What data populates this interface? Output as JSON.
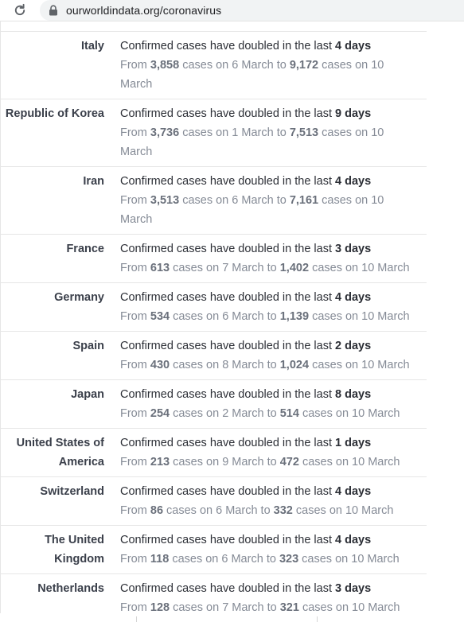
{
  "browser": {
    "url": "ourworldindata.org/coronavirus",
    "reload_icon": "reload-icon",
    "lock_icon": "lock-icon"
  },
  "table": {
    "rows": [
      {
        "country": "Italy",
        "lead": "Confirmed cases have doubled in the last",
        "days": "4 days",
        "from_word": "From",
        "from_cases": "3,858",
        "cases_on_1": "cases on",
        "from_date": "6 March",
        "to_word": "to",
        "to_cases": "9,172",
        "cases_on_2": "cases on",
        "to_date": "10 March"
      },
      {
        "country": "Republic of Korea",
        "lead": "Confirmed cases have doubled in the last",
        "days": "9 days",
        "from_word": "From",
        "from_cases": "3,736",
        "cases_on_1": "cases on",
        "from_date": "1 March",
        "to_word": "to",
        "to_cases": "7,513",
        "cases_on_2": "cases on",
        "to_date": "10 March"
      },
      {
        "country": "Iran",
        "lead": "Confirmed cases have doubled in the last",
        "days": "4 days",
        "from_word": "From",
        "from_cases": "3,513",
        "cases_on_1": "cases on",
        "from_date": "6 March",
        "to_word": "to",
        "to_cases": "7,161",
        "cases_on_2": "cases on",
        "to_date": "10 March"
      },
      {
        "country": "France",
        "lead": "Confirmed cases have doubled in the last",
        "days": "3 days",
        "from_word": "From",
        "from_cases": "613",
        "cases_on_1": "cases on",
        "from_date": "7 March",
        "to_word": "to",
        "to_cases": "1,402",
        "cases_on_2": "cases on",
        "to_date": "10 March"
      },
      {
        "country": "Germany",
        "lead": "Confirmed cases have doubled in the last",
        "days": "4 days",
        "from_word": "From",
        "from_cases": "534",
        "cases_on_1": "cases on",
        "from_date": "6 March",
        "to_word": "to",
        "to_cases": "1,139",
        "cases_on_2": "cases on",
        "to_date": "10 March"
      },
      {
        "country": "Spain",
        "lead": "Confirmed cases have doubled in the last",
        "days": "2 days",
        "from_word": "From",
        "from_cases": "430",
        "cases_on_1": "cases on",
        "from_date": "8 March",
        "to_word": "to",
        "to_cases": "1,024",
        "cases_on_2": "cases on",
        "to_date": "10 March"
      },
      {
        "country": "Japan",
        "lead": "Confirmed cases have doubled in the last",
        "days": "8 days",
        "from_word": "From",
        "from_cases": "254",
        "cases_on_1": "cases on",
        "from_date": "2 March",
        "to_word": "to",
        "to_cases": "514",
        "cases_on_2": "cases on",
        "to_date": "10 March"
      },
      {
        "country": "United States of America",
        "lead": "Confirmed cases have doubled in the last",
        "days": "1 days",
        "from_word": "From",
        "from_cases": "213",
        "cases_on_1": "cases on",
        "from_date": "9 March",
        "to_word": "to",
        "to_cases": "472",
        "cases_on_2": "cases on",
        "to_date": "10 March"
      },
      {
        "country": "Switzerland",
        "lead": "Confirmed cases have doubled in the last",
        "days": "4 days",
        "from_word": "From",
        "from_cases": "86",
        "cases_on_1": "cases on",
        "from_date": "6 March",
        "to_word": "to",
        "to_cases": "332",
        "cases_on_2": "cases on",
        "to_date": "10 March"
      },
      {
        "country": "The United Kingdom",
        "lead": "Confirmed cases have doubled in the last",
        "days": "4 days",
        "from_word": "From",
        "from_cases": "118",
        "cases_on_1": "cases on",
        "from_date": "6 March",
        "to_word": "to",
        "to_cases": "323",
        "cases_on_2": "cases on",
        "to_date": "10 March"
      },
      {
        "country": "Netherlands",
        "lead": "Confirmed cases have doubled in the last",
        "days": "3 days",
        "from_word": "From",
        "from_cases": "128",
        "cases_on_1": "cases on",
        "from_date": "7 March",
        "to_word": "to",
        "to_cases": "321",
        "cases_on_2": "cases on",
        "to_date": "10 March"
      }
    ]
  },
  "colors": {
    "country_text": "#3a3f4a",
    "primary_text": "#2c2f36",
    "secondary_text": "#858b96",
    "divider": "#e6e6e6"
  }
}
